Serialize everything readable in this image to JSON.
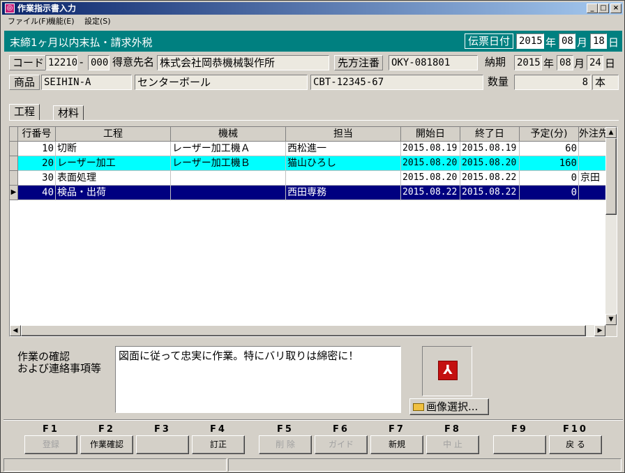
{
  "window": {
    "title": "作業指示書入力",
    "app_icon": "◎",
    "btn_min": "_",
    "btn_max": "□",
    "btn_close": "×"
  },
  "menu": [
    "ファイル(F)",
    "機能(E)",
    "設定(S)"
  ],
  "header": {
    "condition": "末締1ヶ月以内末払・請求外税",
    "slip_date_label": "伝票日付",
    "slip_year": "2015",
    "year_unit": "年",
    "slip_month": "08",
    "month_unit": "月",
    "slip_day": "18",
    "day_unit": "日"
  },
  "order": {
    "code_label": "コード",
    "code": "12210",
    "dash": "-",
    "code_sub": "000",
    "customer_label": "得意先名",
    "customer": "株式会社岡恭機械製作所",
    "order_no_label": "先方注番",
    "order_no": "OKY-081801",
    "due_label": "納期",
    "due_year": "2015",
    "due_month": "08",
    "due_day": "24",
    "product_label": "商品",
    "product_code": "SEIHIN-A",
    "product_name": "センターボール",
    "product_no": "CBT-12345-67",
    "qty_label": "数量",
    "qty": "8",
    "qty_unit": "本"
  },
  "tabs": [
    "工程",
    "材料"
  ],
  "grid": {
    "columns": [
      "行番号",
      "工程",
      "機械",
      "担当",
      "開始日",
      "終了日",
      "予定(分)",
      "外注先"
    ],
    "rows": [
      {
        "no": "10",
        "process": "切断",
        "machine": "レーザー加工機Ａ",
        "staff": "西松進一",
        "start": "2015.08.19",
        "end": "2015.08.19",
        "minutes": "60",
        "vendor": ""
      },
      {
        "no": "20",
        "process": "レーザー加工",
        "machine": "レーザー加工機Ｂ",
        "staff": "猫山ひろし",
        "start": "2015.08.20",
        "end": "2015.08.20",
        "minutes": "160",
        "vendor": ""
      },
      {
        "no": "30",
        "process": "表面処理",
        "machine": "",
        "staff": "",
        "start": "2015.08.20",
        "end": "2015.08.22",
        "minutes": "0",
        "vendor": "京田"
      },
      {
        "no": "40",
        "process": "検品・出荷",
        "machine": "",
        "staff": "西田専務",
        "start": "2015.08.22",
        "end": "2015.08.22",
        "minutes": "0",
        "vendor": ""
      }
    ],
    "current_row_marker": "▶",
    "highlight_color": "#00ffff",
    "selected_color": "#000080"
  },
  "notes": {
    "label_line1": "作業の確認",
    "label_line2": "および連絡事項等",
    "text": "図面に従って忠実に作業。特にバリ取りは綿密に！"
  },
  "image": {
    "icon": "pdf-icon",
    "select_label": "画像選択..."
  },
  "fkeys": [
    {
      "key": "F1",
      "label": "登録",
      "enabled": false
    },
    {
      "key": "F2",
      "label": "作業確認",
      "enabled": true
    },
    {
      "key": "F3",
      "label": "",
      "enabled": true
    },
    {
      "key": "F4",
      "label": "訂正",
      "enabled": true
    },
    {
      "key": "F5",
      "label": "削 除",
      "enabled": false
    },
    {
      "key": "F6",
      "label": "ガイド",
      "enabled": false
    },
    {
      "key": "F7",
      "label": "新規",
      "enabled": true
    },
    {
      "key": "F8",
      "label": "中 止",
      "enabled": false
    },
    {
      "key": "F9",
      "label": "",
      "enabled": true
    },
    {
      "key": "F10",
      "label": "戻 る",
      "enabled": true
    }
  ]
}
